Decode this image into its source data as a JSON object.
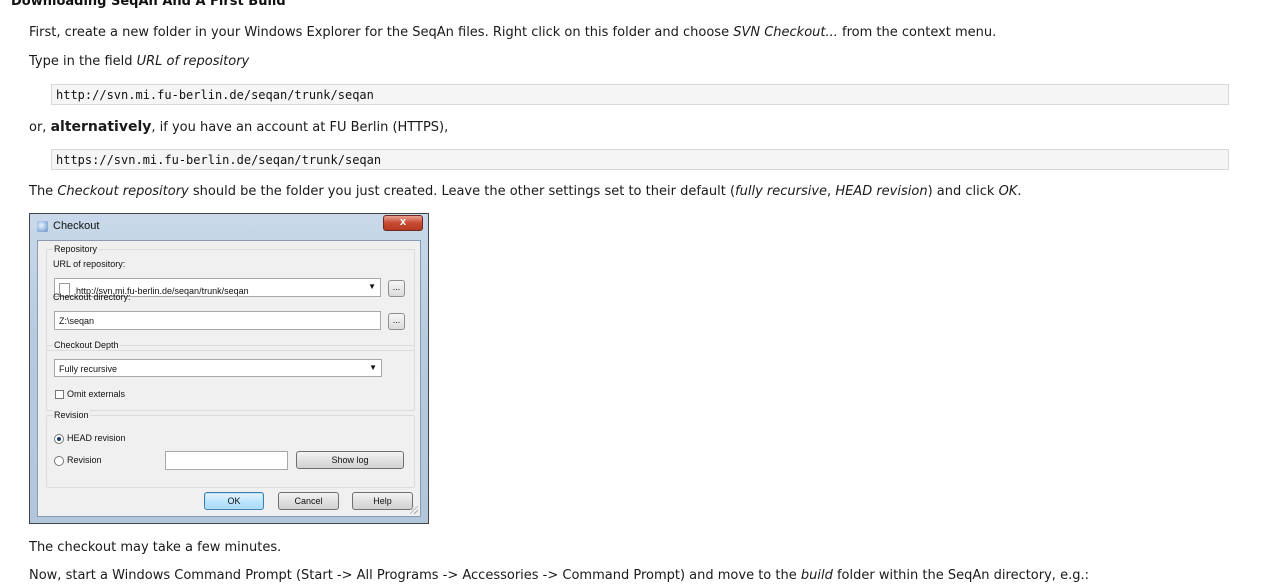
{
  "heading": "Downloading SeqAn And A First Build",
  "p1": {
    "before": "First, create a new folder in your Windows Explorer for the SeqAn files. Right click on this folder and choose ",
    "em": "SVN Checkout...",
    "after": " from the context menu."
  },
  "p2": {
    "before": "Type in the field ",
    "em": "URL of repository"
  },
  "code1": "http://svn.mi.fu-berlin.de/seqan/trunk/seqan",
  "p3": {
    "before": "or, ",
    "strong": "alternatively",
    "after": ", if you have an account at FU Berlin (HTTPS),"
  },
  "code2": "https://svn.mi.fu-berlin.de/seqan/trunk/seqan",
  "p4": {
    "t1": "The ",
    "em1": "Checkout repository",
    "t2": " should be the folder you just created. Leave the other settings set to their default (",
    "em2": "fully recursive",
    "t3": ", ",
    "em3": "HEAD revision",
    "t4": ") and click ",
    "em4": "OK",
    "t5": "."
  },
  "dialog": {
    "title": "Checkout",
    "close": "x",
    "repository_group": "Repository",
    "url_label": "URL of repository:",
    "url_value": "http://svn.mi.fu-berlin.de/seqan/trunk/seqan",
    "browse": "...",
    "dir_label": "Checkout directory:",
    "dir_value": "Z:\\seqan",
    "depth_group": "Checkout Depth",
    "depth_value": "Fully recursive",
    "omit_externals": "Omit externals",
    "revision_group": "Revision",
    "head_revision": "HEAD revision",
    "revision": "Revision",
    "show_log": "Show log",
    "ok": "OK",
    "cancel": "Cancel",
    "help": "Help"
  },
  "p5": "The checkout may take a few minutes.",
  "p6": {
    "t1": "Now, start a Windows Command Prompt (Start -> All Programs -> Accessories -> Command Prompt) and move to the ",
    "em": "build",
    "t2": " folder within the SeqAn directory, e.g.:"
  }
}
